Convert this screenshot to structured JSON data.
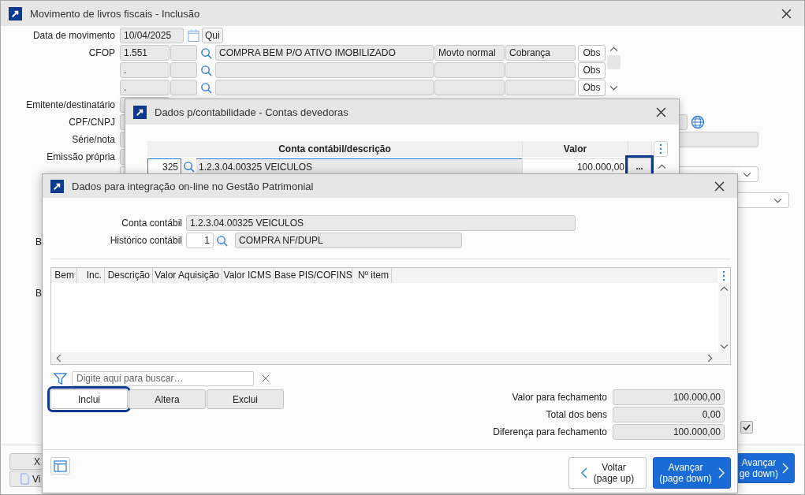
{
  "main_window": {
    "title": "Movimento de livros fiscais - Inclusão",
    "movement_date": {
      "label": "Data de movimento",
      "value": "10/04/2025",
      "weekday": "Qui"
    },
    "cfop": {
      "label": "CFOP",
      "rows": [
        {
          "code": "1.551",
          "description": "COMPRA BEM P/O ATIVO IMOBILIZADO",
          "movement": "Movto normal",
          "billing": "Cobrança",
          "obs": "Obs"
        },
        {
          "code": ".",
          "description": "",
          "movement": "",
          "billing": "",
          "obs": "Obs"
        },
        {
          "code": ".",
          "description": "",
          "movement": "",
          "billing": "",
          "obs": "Obs"
        }
      ]
    },
    "labels": [
      "Emitente/destinatário",
      "CPF/CNPJ",
      "Série/nota",
      "Emissão própria"
    ],
    "partial_labels": [
      "B",
      "B"
    ],
    "option_checkbox": {
      "checked": true
    },
    "bottom_buttons": [
      "X",
      "Vi"
    ],
    "next_button": {
      "line1": "Avançar",
      "line2": "ge down)"
    }
  },
  "accounts_window": {
    "title": "Dados p/contabilidade - Contas devedoras",
    "columns": [
      "Conta contábil/descrição",
      "Valor"
    ],
    "rows": [
      {
        "code": "325",
        "account": "1.2.3.04.00325 VEICULOS",
        "value": "100.000,00",
        "more": "...",
        "focused": true
      }
    ]
  },
  "integration_window": {
    "title": "Dados para integração on-line no Gestão Patrimonial",
    "account": {
      "label": "Conta contábil",
      "value": "1.2.3.04.00325 VEICULOS"
    },
    "history": {
      "label": "Histórico contábil",
      "code": "1",
      "description": "COMPRA NF/DUPL"
    },
    "columns": [
      "Bem",
      "Inc.",
      "Descrição",
      "Valor Aquisição",
      "Valor ICMS",
      "Base PIS/COFINS",
      "Nº item"
    ],
    "search": {
      "placeholder": "Digite aqui para buscar…"
    },
    "actions": [
      {
        "label": "Inclui",
        "selected": true
      },
      {
        "label": "Altera",
        "selected": false
      },
      {
        "label": "Exclui",
        "selected": false
      }
    ],
    "totals": [
      {
        "label": "Valor para fechamento",
        "value": "100.000,00"
      },
      {
        "label": "Total dos bens",
        "value": "0,00"
      },
      {
        "label": "Diferença para fechamento",
        "value": "100.000,00"
      }
    ],
    "back_button": {
      "line1": "Voltar",
      "line2": "(page up)"
    },
    "next_button": {
      "line1": "Avançar",
      "line2": "(page down)"
    }
  }
}
